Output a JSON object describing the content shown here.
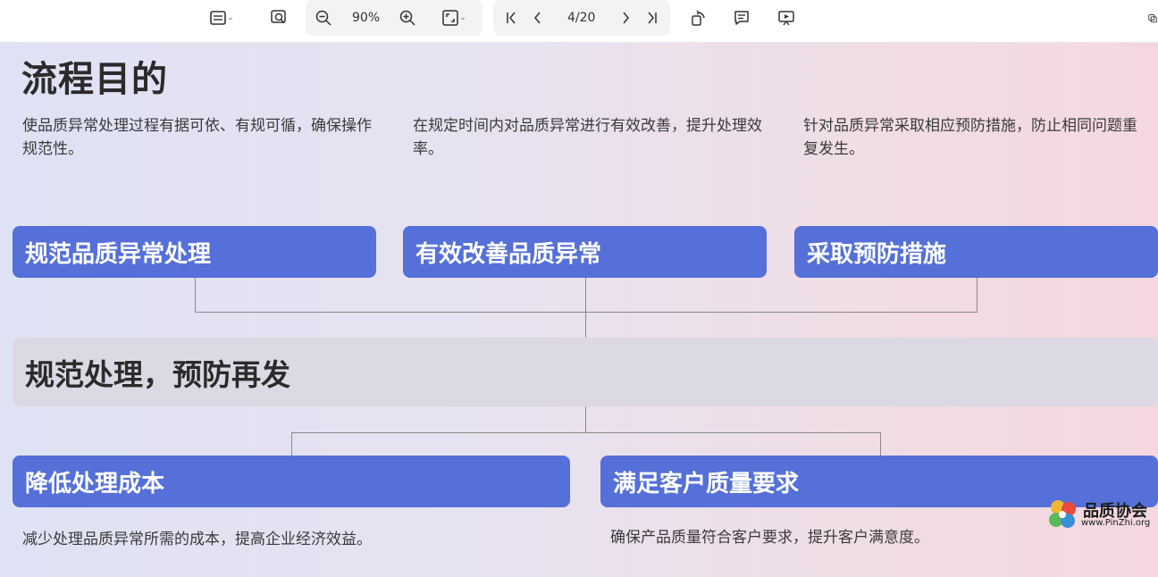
{
  "toolbar": {
    "zoom": "90%",
    "page": "4/20",
    "icons": [
      "view-mode-icon",
      "search-icon",
      "zoom-out-icon",
      "zoom-in-icon",
      "fit-page-icon",
      "first-page-icon",
      "prev-page-icon",
      "next-page-icon",
      "last-page-icon",
      "rotate-icon",
      "comment-icon",
      "present-icon",
      "more-icon"
    ]
  },
  "slide": {
    "title": "流程目的",
    "purposes": [
      {
        "desc": "使品质异常处理过程有据可依、有规可循，确保操作规范性。",
        "label": "规范品质异常处理"
      },
      {
        "desc": "在规定时间内对品质异常进行有效改善，提升处理效率。",
        "label": "有效改善品质异常"
      },
      {
        "desc": "针对品质异常采取相应预防措施，防止相同问题重复发生。",
        "label": "采取预防措施"
      }
    ],
    "center": "规范处理，预防再发",
    "outcomes": [
      {
        "label": "降低处理成本",
        "desc": "减少处理品质异常所需的成本，提高企业经济效益。"
      },
      {
        "label": "满足客户质量要求",
        "desc": "确保产品质量符合客户要求，提升客户满意度。"
      }
    ]
  },
  "watermark": {
    "cn": "品质协会",
    "en": "www.PinZhi.org"
  }
}
